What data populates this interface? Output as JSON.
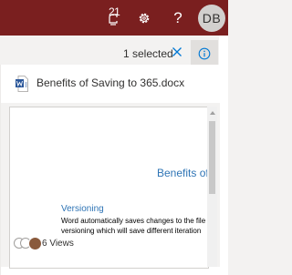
{
  "suite_bar": {
    "notification_count": "21",
    "avatar_initials": "DB",
    "help_label": "?",
    "background_color": "#7a1f1f",
    "icons": [
      "notifications-icon",
      "gear-icon",
      "help-icon"
    ]
  },
  "command_bar": {
    "selection_text": "1 selected",
    "icons": [
      "close-icon",
      "info-icon"
    ],
    "accent_color": "#0078d4"
  },
  "details_pane": {
    "file_name": "Benefits of Saving to 365.docx",
    "file_icon": "word-document-icon",
    "preview": {
      "title": "Benefits of",
      "heading": "Versioning",
      "body_lines": [
        "Word automatically saves changes to the file",
        "versioning which will save different iteration"
      ]
    },
    "views": {
      "label": "6 Views",
      "viewer_icons": [
        "person-icon",
        "person-icon",
        "viewer-photo"
      ]
    }
  }
}
